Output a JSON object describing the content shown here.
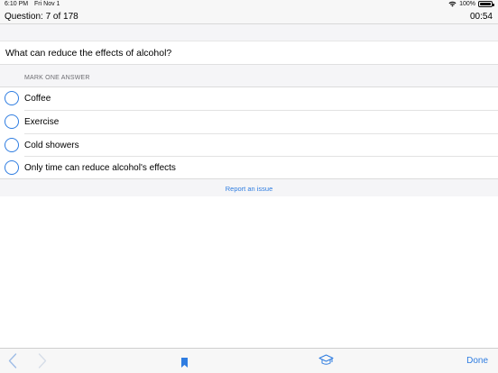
{
  "status_bar": {
    "time": "6:10 PM",
    "date": "Fri Nov 1",
    "battery": "100%",
    "battery_level": 1.0
  },
  "nav": {
    "title": "Question: 7 of 178",
    "timer": "00:54"
  },
  "question": {
    "text": "What can reduce the effects of alcohol?"
  },
  "answers_header": "MARK ONE ANSWER",
  "answers": [
    {
      "label": "Coffee",
      "selected": false
    },
    {
      "label": "Exercise",
      "selected": false
    },
    {
      "label": "Cold showers",
      "selected": false
    },
    {
      "label": "Only time can reduce alcohol's effects",
      "selected": false
    }
  ],
  "report_link": "Report an issue",
  "toolbar": {
    "done_label": "Done",
    "icons": [
      "chevron-left-icon",
      "chevron-right-icon",
      "bookmark-icon",
      "graduation-cap-icon"
    ]
  },
  "colors": {
    "accent": "#2f7de1",
    "background": "#f5f5f7"
  }
}
